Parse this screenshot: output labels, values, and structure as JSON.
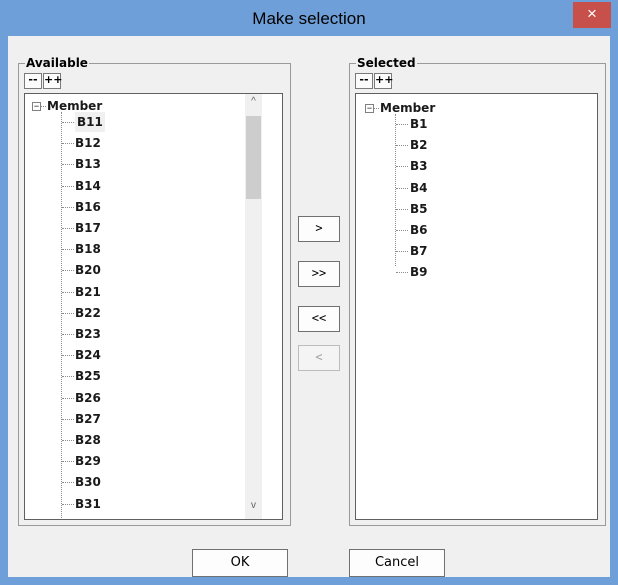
{
  "window": {
    "title": "Make selection",
    "close_glyph": "×"
  },
  "available": {
    "label": "Available",
    "collapse_all": "--",
    "expand_all": "++",
    "root": "Member",
    "expander_glyph": "−",
    "items": [
      "B11",
      "B12",
      "B13",
      "B14",
      "B16",
      "B17",
      "B18",
      "B20",
      "B21",
      "B22",
      "B23",
      "B24",
      "B25",
      "B26",
      "B27",
      "B28",
      "B29",
      "B30",
      "B31"
    ],
    "scroll_up": "^",
    "scroll_down": "v"
  },
  "selected": {
    "label": "Selected",
    "collapse_all": "--",
    "expand_all": "++",
    "root": "Member",
    "expander_glyph": "−",
    "items": [
      "B1",
      "B2",
      "B3",
      "B4",
      "B5",
      "B6",
      "B7",
      "B9"
    ]
  },
  "transfer": {
    "add": ">",
    "add_all": ">>",
    "remove_all": "<<",
    "remove": "<"
  },
  "buttons": {
    "ok": "OK",
    "cancel": "Cancel"
  }
}
